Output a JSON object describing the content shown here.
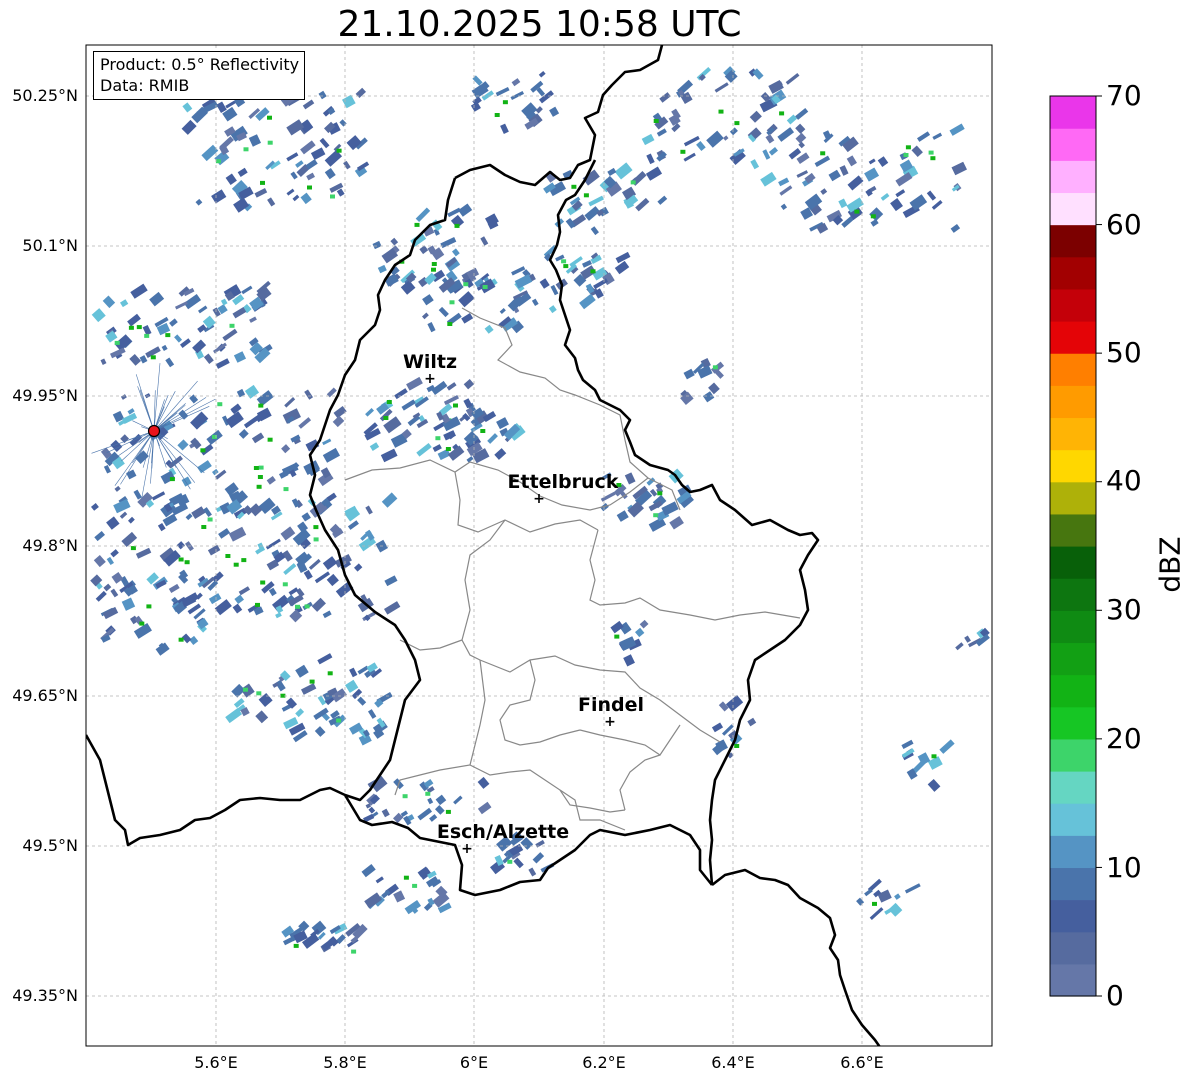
{
  "title": "21.10.2025 10:58 UTC",
  "info": {
    "product": "Product: 0.5° Reflectivity",
    "data": "Data: RMIB"
  },
  "axes": {
    "lat_labels": [
      "50.25°N",
      "50.1°N",
      "49.95°N",
      "49.8°N",
      "49.65°N",
      "49.5°N",
      "49.35°N"
    ],
    "lon_labels": [
      "5.6°E",
      "5.8°E",
      "6°E",
      "6.2°E",
      "6.4°E",
      "6.6°E"
    ]
  },
  "cities": [
    {
      "name": "Wiltz"
    },
    {
      "name": "Ettelbruck"
    },
    {
      "name": "Findel"
    },
    {
      "name": "Esch/Alzette"
    }
  ],
  "radar_site": {
    "color": "#e8141c"
  },
  "colorbar": {
    "label": "dBZ",
    "ticks": [
      "70",
      "60",
      "50",
      "40",
      "30",
      "20",
      "10",
      "0"
    ],
    "colors": [
      "#6577a8",
      "#566b9f",
      "#455f9e",
      "#4a74ab",
      "#5594c4",
      "#66c2d9",
      "#65d6c2",
      "#3dd46a",
      "#16c624",
      "#12b315",
      "#12a014",
      "#0f8b13",
      "#0d7610",
      "#086009",
      "#47760f",
      "#aeb109",
      "#ffd700",
      "#ffb405",
      "#ff9b00",
      "#ff7f00",
      "#e40407",
      "#c40009",
      "#a20001",
      "#7c0000",
      "#ffe0ff",
      "#ffb0ff",
      "#ff69f5",
      "#ea36ea"
    ]
  },
  "legend_colors": {
    "border": "#000000",
    "region": "#888888",
    "grid": "#b4b4b4"
  }
}
